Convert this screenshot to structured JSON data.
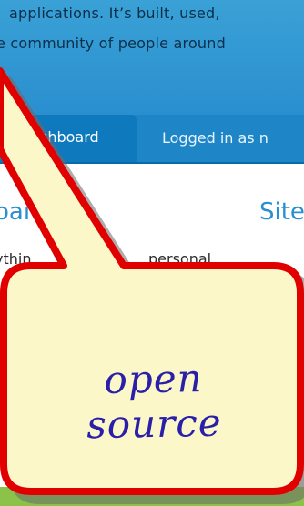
{
  "hero": {
    "line1": "applications. It’s built, used,",
    "line2": "e community of people around"
  },
  "nav": {
    "active_tab_label": "shboard",
    "logged_in_text": "Logged in as n"
  },
  "content": {
    "left_heading": "oai",
    "right_heading": "Site",
    "line1": "ythin",
    "line1b": "personal"
  },
  "callout": {
    "text": "open source",
    "fill_color": "#fbf7c9",
    "border_color": "#e00000"
  }
}
